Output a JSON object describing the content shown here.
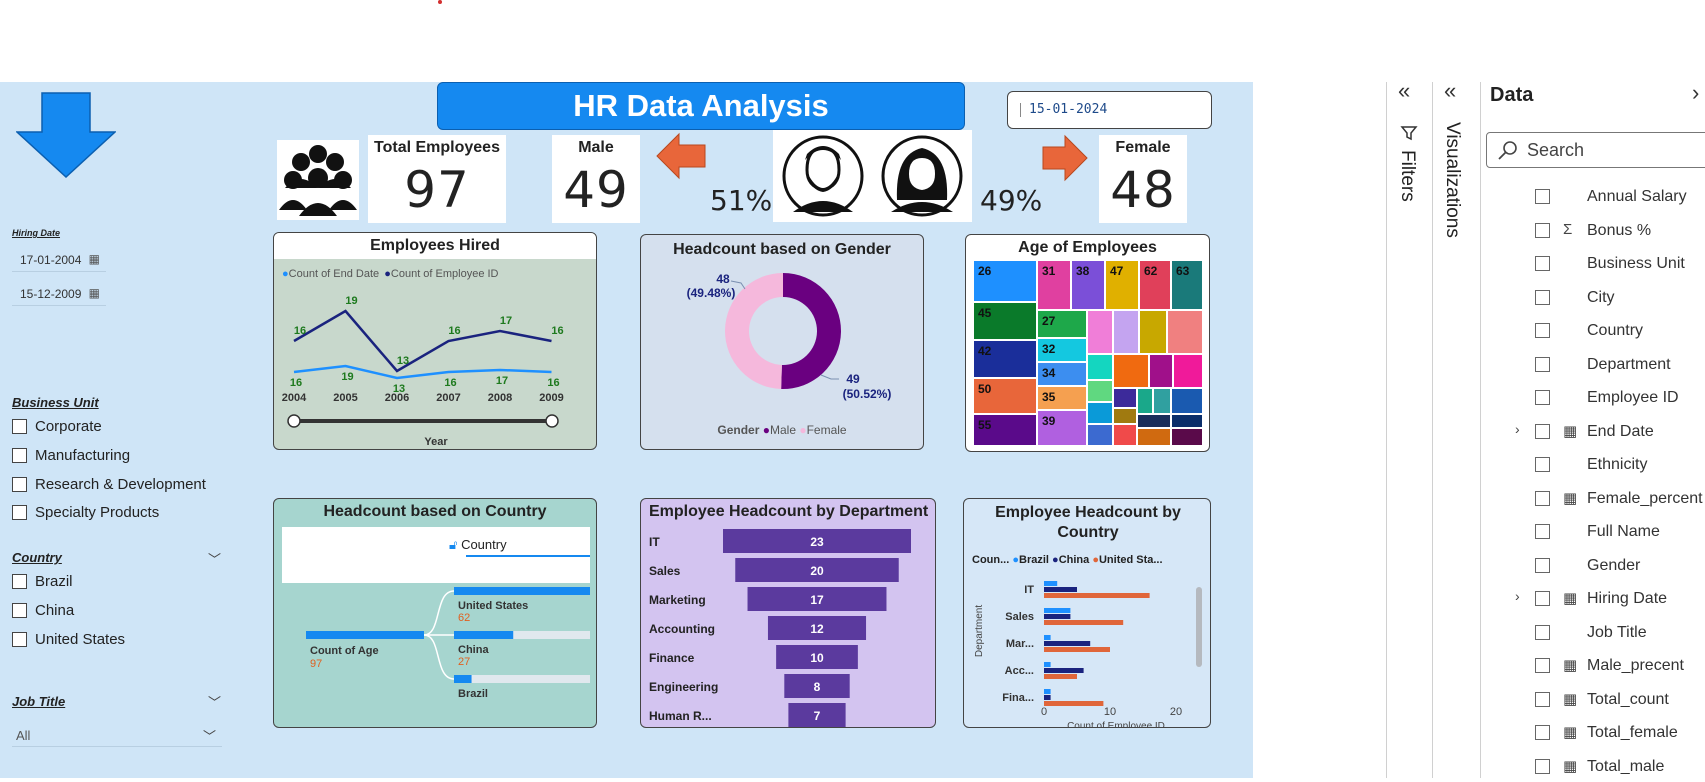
{
  "dashboard": {
    "title": "HR Data Analysis",
    "selected_date": "15-01-2024",
    "total_employees_label": "Total Employees",
    "total_employees": "97",
    "male_label": "Male",
    "male_count": "49",
    "male_pct": "51%",
    "female_label": "Female",
    "female_count": "48",
    "female_pct": "49%"
  },
  "slicers": {
    "hiring_date": {
      "title": "Hiring Date",
      "start": "17-01-2004",
      "end": "15-12-2009"
    },
    "business_unit": {
      "title": "Business Unit",
      "options": [
        "Corporate",
        "Manufacturing",
        "Research & Development",
        "Specialty Products"
      ]
    },
    "country": {
      "title": "Country",
      "options": [
        "Brazil",
        "China",
        "United States"
      ]
    },
    "job_title": {
      "title": "Job Title",
      "value": "All"
    }
  },
  "chart_data": [
    {
      "id": "employees_hired",
      "type": "line",
      "title": "Employees Hired",
      "xlabel": "Year",
      "categories": [
        "2004",
        "2005",
        "2006",
        "2007",
        "2008",
        "2009"
      ],
      "series": [
        {
          "name": "Count of End Date",
          "values": [
            16,
            19,
            13,
            16,
            17,
            16
          ],
          "color": "#1e90ff"
        },
        {
          "name": "Count of Employee ID",
          "values": [
            16,
            19,
            13,
            16,
            17,
            16
          ],
          "color": "#1a237e"
        }
      ],
      "labels_top": [
        "16",
        "19",
        "13",
        "16",
        "17",
        "16"
      ],
      "labels_bottom": [
        "16",
        "19",
        "13",
        "16",
        "17",
        "16"
      ]
    },
    {
      "id": "headcount_gender",
      "type": "pie",
      "title": "Headcount based on Gender",
      "legend_title": "Gender",
      "slices": [
        {
          "name": "Male",
          "value": 49,
          "pct": "(50.52%)",
          "color": "#6a0080"
        },
        {
          "name": "Female",
          "value": 48,
          "pct": "(49.48%)",
          "color": "#f5b8dc"
        }
      ]
    },
    {
      "id": "age_of_employees",
      "type": "heatmap",
      "title": "Age of Employees",
      "labels": [
        "26",
        "31",
        "38",
        "47",
        "62",
        "63",
        "45",
        "27",
        "42",
        "32",
        "34",
        "50",
        "35",
        "55",
        "39"
      ]
    },
    {
      "id": "headcount_country_tree",
      "type": "bar",
      "title": "Headcount based on Country",
      "root_label": "Count of Age",
      "root_value": "97",
      "filter_label": "Country",
      "categories": [
        "United States",
        "China",
        "Brazil"
      ],
      "values": [
        62,
        27,
        8
      ]
    },
    {
      "id": "headcount_department",
      "type": "bar",
      "title": "Employee Headcount by Department",
      "categories": [
        "IT",
        "Sales",
        "Marketing",
        "Accounting",
        "Finance",
        "Engineering",
        "Human R..."
      ],
      "values": [
        23,
        20,
        17,
        12,
        10,
        8,
        7
      ]
    },
    {
      "id": "headcount_dept_country",
      "type": "bar",
      "title": "Employee Headcount by Country",
      "legend_title": "Coun...",
      "ylabel": "Department",
      "xlabel": "Count of Employee ID",
      "categories": [
        "IT",
        "Sales",
        "Mar...",
        "Acc...",
        "Fina..."
      ],
      "series": [
        {
          "name": "Brazil",
          "values": [
            2,
            4,
            1,
            1,
            1
          ],
          "color": "#1e90ff"
        },
        {
          "name": "China",
          "values": [
            5,
            4,
            7,
            6,
            1
          ],
          "color": "#1a237e"
        },
        {
          "name": "United Sta...",
          "values": [
            16,
            12,
            10,
            5,
            9
          ],
          "color": "#e0663a"
        }
      ],
      "xticks": [
        "0",
        "10",
        "20"
      ],
      "xlim": [
        0,
        20
      ]
    }
  ],
  "panes": {
    "filters_label": "Filters",
    "visualizations_label": "Visualizations",
    "data_title": "Data",
    "search_placeholder": "Search",
    "fields": [
      {
        "name": "Annual Salary",
        "type": "",
        "expand": false
      },
      {
        "name": "Bonus %",
        "type": "sum",
        "expand": false
      },
      {
        "name": "Business Unit",
        "type": "",
        "expand": false
      },
      {
        "name": "City",
        "type": "",
        "expand": false
      },
      {
        "name": "Country",
        "type": "",
        "expand": false
      },
      {
        "name": "Department",
        "type": "",
        "expand": false
      },
      {
        "name": "Employee ID",
        "type": "",
        "expand": false
      },
      {
        "name": "End Date",
        "type": "calendar",
        "expand": true
      },
      {
        "name": "Ethnicity",
        "type": "",
        "expand": false
      },
      {
        "name": "Female_percent",
        "type": "calc",
        "expand": false
      },
      {
        "name": "Full Name",
        "type": "",
        "expand": false
      },
      {
        "name": "Gender",
        "type": "",
        "expand": false
      },
      {
        "name": "Hiring Date",
        "type": "calendar",
        "expand": true
      },
      {
        "name": "Job Title",
        "type": "",
        "expand": false
      },
      {
        "name": "Male_precent",
        "type": "calc",
        "expand": false
      },
      {
        "name": "Total_count",
        "type": "calc",
        "expand": false
      },
      {
        "name": "Total_female",
        "type": "calc",
        "expand": false
      },
      {
        "name": "Total_male",
        "type": "calc",
        "expand": false
      }
    ]
  }
}
